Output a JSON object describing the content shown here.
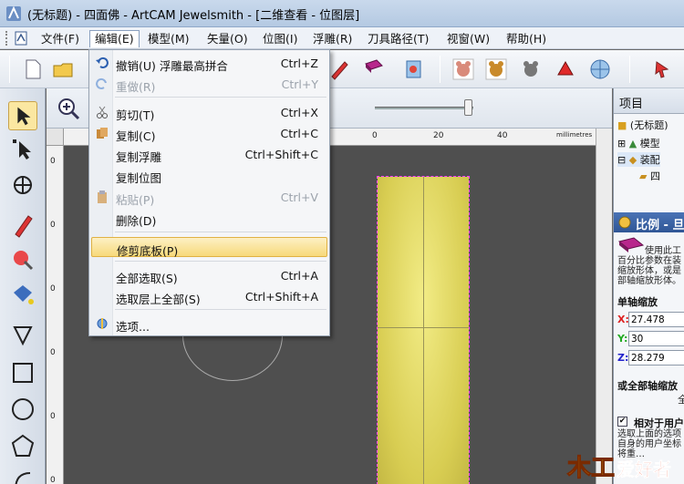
{
  "window": {
    "title": "(无标题) - 四面佛 - ArtCAM Jewelsmith - [二维查看 - 位图层]"
  },
  "menubar": {
    "items": [
      {
        "label": "文件(F)"
      },
      {
        "label": "编辑(E)"
      },
      {
        "label": "模型(M)"
      },
      {
        "label": "矢量(O)"
      },
      {
        "label": "位图(I)"
      },
      {
        "label": "浮雕(R)"
      },
      {
        "label": "刀具路径(T)"
      },
      {
        "label": "视窗(W)"
      },
      {
        "label": "帮助(H)"
      }
    ],
    "active_index": 1
  },
  "edit_menu": {
    "items": [
      {
        "label": "撤销(U) 浮雕最高拼合",
        "shortcut": "Ctrl+Z",
        "icon": "undo-icon",
        "enabled": true
      },
      {
        "label": "重做(R)",
        "shortcut": "Ctrl+Y",
        "icon": "redo-icon",
        "enabled": false
      },
      {
        "label": "剪切(T)",
        "shortcut": "Ctrl+X",
        "icon": "cut-icon",
        "enabled": true
      },
      {
        "label": "复制(C)",
        "shortcut": "Ctrl+C",
        "icon": "copy-icon",
        "enabled": true
      },
      {
        "label": "复制浮雕",
        "shortcut": "Ctrl+Shift+C",
        "icon": "",
        "enabled": true
      },
      {
        "label": "复制位图",
        "shortcut": "",
        "icon": "",
        "enabled": true
      },
      {
        "label": "粘贴(P)",
        "shortcut": "Ctrl+V",
        "icon": "paste-icon",
        "enabled": false
      },
      {
        "label": "删除(D)",
        "shortcut": "",
        "icon": "",
        "enabled": true
      },
      {
        "label": "修剪底板(P)",
        "shortcut": "",
        "icon": "",
        "enabled": true,
        "highlighted": true
      },
      {
        "label": "全部选取(S)",
        "shortcut": "Ctrl+A",
        "icon": "",
        "enabled": true
      },
      {
        "label": "选取层上全部(S)",
        "shortcut": "Ctrl+Shift+A",
        "icon": "",
        "enabled": true
      },
      {
        "label": "选项...",
        "shortcut": "",
        "icon": "options-icon",
        "enabled": true
      }
    ]
  },
  "ruler": {
    "top_ticks": [
      "0",
      "20",
      "40"
    ],
    "unit": "millimetres",
    "left_ticks": [
      "0",
      "0",
      "0",
      "0",
      "0",
      "0",
      "0"
    ]
  },
  "project_panel": {
    "header": "项目",
    "tree": [
      {
        "label": "(无标题)"
      },
      {
        "label": "模型"
      },
      {
        "label": "装配"
      },
      {
        "label": "四"
      }
    ]
  },
  "scale_panel": {
    "title": "比例 - 旦",
    "desc_lines": [
      "使用此工",
      "百分比参数在装",
      "缩放形体，或是",
      "部轴缩放形体。"
    ],
    "single_axis_label": "单轴缩放",
    "x_label": "X:",
    "x_value": "27.478",
    "y_label": "Y:",
    "y_value": "30",
    "z_label": "Z:",
    "z_value": "28.279",
    "all_axis_label": "或全部轴缩放",
    "all_axis_tail": "全",
    "relative_label": "相对于用户",
    "relative_desc": [
      "选取上面的选项",
      "自身的用户坐标",
      "将重…"
    ]
  },
  "watermark": {
    "text": "爱好者"
  },
  "colors": {
    "relief_yellow": "#e2d763",
    "selection_outline": "#ff3cff",
    "menu_highlight": "#f7d97a",
    "panel_title_blue": "#2f5696"
  }
}
